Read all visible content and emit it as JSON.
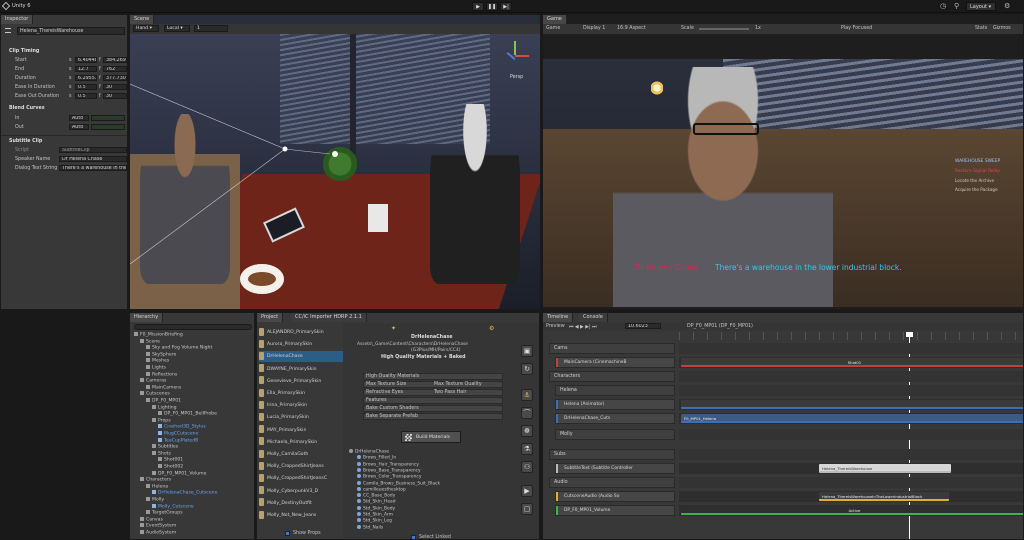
{
  "toolbar": {
    "project_name": "Unity 6",
    "play_icon": "play-icon",
    "pause_icon": "pause-icon",
    "step_icon": "step-icon",
    "layout_label": "Layout",
    "history_icon": "history-icon",
    "search_icon": "search-icon",
    "settings_icon": "gear-icon"
  },
  "inspector": {
    "tab": "Inspector",
    "object_name": "Helena_ThereisWarehouse",
    "clip_timing": "Clip Timing",
    "start_label": "Start",
    "start_s": "6.40448",
    "start_f": "384.269",
    "end_label": "End",
    "end_s": "12.7",
    "end_f": "762",
    "duration_label": "Duration",
    "duration_s": "6.29551",
    "duration_f": "377.7306",
    "ease_in_label": "Ease In Duration",
    "ease_in_s": "0.5",
    "ease_in_f": "30",
    "ease_out_label": "Ease Out Duration",
    "ease_out_s": "0.5",
    "ease_out_f": "30",
    "blend_curves": "Blend Curves",
    "in_label": "In",
    "in_value": "Auto",
    "out_label": "Out",
    "out_value": "Auto",
    "subtitle_clip": "Subtitle Clip",
    "script_label": "Script",
    "script_value": "SubtitleClip",
    "speaker_label": "Speaker Name",
    "speaker_value": "Dr Helena Chase",
    "dialog_label": "Dialog Text String",
    "dialog_value": "There's a warehouse in the lo"
  },
  "scene": {
    "tab": "Scene",
    "hand_tool": "Hand",
    "local_label": "Local",
    "grid_value": "1",
    "persp_label": "Persp"
  },
  "game": {
    "tab": "Game",
    "game_label": "Game",
    "display_label": "Display 1",
    "aspect_label": "16:9 Aspect",
    "scale_label": "Scale",
    "scale_value": "1x",
    "play_focused": "Play Focused",
    "stats_label": "Stats",
    "gizmos_label": "Gizmos",
    "subtitle_speaker": "Dr Helena Chase",
    "subtitle_text": "There's a warehouse in the lower industrial block.",
    "objectives": [
      "WAREHOUSE SWEEP",
      "Restore Signal Relay",
      "Locate the Archive",
      "Acquire the Package"
    ],
    "speaker_color": "#e0245a",
    "subtitle_color": "#3ac6e8"
  },
  "hierarchy": {
    "tab": "Hierarchy",
    "items": [
      {
        "label": "F0_MissionBriefing",
        "indent": 0,
        "blue": false
      },
      {
        "label": "Scene",
        "indent": 1,
        "blue": false
      },
      {
        "label": "Sky and Fog Volume Night",
        "indent": 2,
        "blue": false
      },
      {
        "label": "SkySphere",
        "indent": 2,
        "blue": false
      },
      {
        "label": "Meshes",
        "indent": 2,
        "blue": false
      },
      {
        "label": "Lights",
        "indent": 2,
        "blue": false
      },
      {
        "label": "Reflections",
        "indent": 2,
        "blue": false
      },
      {
        "label": "Cameras",
        "indent": 1,
        "blue": false
      },
      {
        "label": "MainCamera",
        "indent": 2,
        "blue": false
      },
      {
        "label": "Cutscenes",
        "indent": 1,
        "blue": false
      },
      {
        "label": "DP_F0_MP01",
        "indent": 2,
        "blue": false
      },
      {
        "label": "Lighting",
        "indent": 3,
        "blue": false
      },
      {
        "label": "DP_F0_MP01_BellProbe",
        "indent": 4,
        "blue": false
      },
      {
        "label": "Props",
        "indent": 3,
        "blue": false
      },
      {
        "label": "Crashed3D_Stylus",
        "indent": 4,
        "blue": true
      },
      {
        "label": "MugCCutscene",
        "indent": 4,
        "blue": true
      },
      {
        "label": "TeaCupPlatedB",
        "indent": 4,
        "blue": true
      },
      {
        "label": "Subtitles",
        "indent": 3,
        "blue": false
      },
      {
        "label": "Shots",
        "indent": 3,
        "blue": false
      },
      {
        "label": "Shot001",
        "indent": 4,
        "blue": false
      },
      {
        "label": "Shot002",
        "indent": 4,
        "blue": false
      },
      {
        "label": "DP_F0_MP01_Volume",
        "indent": 3,
        "blue": false
      },
      {
        "label": "Characters",
        "indent": 1,
        "blue": false
      },
      {
        "label": "Helena",
        "indent": 2,
        "blue": false
      },
      {
        "label": "DrHelenaChase_Cutscene",
        "indent": 3,
        "blue": true
      },
      {
        "label": "Molly",
        "indent": 2,
        "blue": false
      },
      {
        "label": "Molly_Cutscene",
        "indent": 3,
        "blue": true
      },
      {
        "label": "TargetGroups",
        "indent": 2,
        "blue": false
      },
      {
        "label": "Canvas",
        "indent": 1,
        "blue": false
      },
      {
        "label": "EventSystem",
        "indent": 1,
        "blue": false
      },
      {
        "label": "AudioSystem",
        "indent": 1,
        "blue": false
      }
    ]
  },
  "project": {
    "tab": "Project",
    "items": [
      "ALEJANDRO_PrimarySkin",
      "Aurora_PrimarySkin",
      "DrHelenaChase",
      "DWAYNE_PrimarySkin",
      "Genevieve_PrimarySkin",
      "Ella_PrimarySkin",
      "Irina_PrimarySkin",
      "Lucia_PrimarySkin",
      "MAY_PrimarySkin",
      "Michaela_PrimarySkin",
      "Molly_CamilaGoth",
      "Molly_CroppedShirtJeans",
      "Molly_CroppedShirtJeansC",
      "Molly_CyberpunkV3_D",
      "Molly_DestinyOutfit",
      "Molly_Not_New_Jeans"
    ],
    "selected": "DrHelenaChase",
    "show_props": "Show Props"
  },
  "importer": {
    "tab": "CC/iC Importer HDRP 2.1.1",
    "name": "DrHelenaChase",
    "path": "Assets\\_Game\\Content\\Characters\\DrHelenaChase",
    "sub_path": "(G3Plus/MH/Pairs/CC4)",
    "quality": "High Quality Materials + Baked",
    "options": [
      {
        "label": "High Quality Materials",
        "value": ""
      },
      {
        "label": "Max Texture Size",
        "value": "Max Texture Quality"
      },
      {
        "label": "Refractive Eyes",
        "value": "Two Pass Hair"
      },
      {
        "label": "Features",
        "value": ""
      },
      {
        "label": "Bake Custom Shaders",
        "value": ""
      },
      {
        "label": "Bake Separate Prefab",
        "value": ""
      }
    ],
    "build_button": "Build Materials",
    "tree": [
      "DrHelenaChase",
      "Brows_Filled_In",
      "Brows_Hair_Transparency",
      "Brows_Base_Transparency",
      "Brows_Color_Transparency",
      "Camila_Brows_Business_Suit_Black",
      "camilleuesthesktop",
      "CC_Base_Body",
      "Std_Skin_Head",
      "Std_Skin_Body",
      "Std_Skin_Arm",
      "Std_Skin_Leg",
      "Std_Nails"
    ],
    "select_linked": "Select Linked"
  },
  "timeline": {
    "tab": "Timeline",
    "console_tab": "Console",
    "preview_label": "Preview",
    "time_value": "10.6023",
    "sequence": "DP_F0_MP01 (DP_F0_MP01)",
    "groups": [
      "Cams",
      "Characters",
      "Helena",
      "Molly",
      "Subs",
      "Audio"
    ],
    "tracks": [
      {
        "label": "MainCamera (CinemachineB",
        "clip": "Shot01",
        "color": "#c44040"
      },
      {
        "label": "Helena (Animator)",
        "clip": "",
        "color": "#3a70b8"
      },
      {
        "label": "DrHelenaChase_Cuts",
        "clip": "F0_MP01_Helena",
        "color": "#3a70b8"
      },
      {
        "label": "SubtitleText (Subtitle Controller",
        "clip": "Helena_ThereisWarehouse",
        "color": "#bbbbbb"
      },
      {
        "label": "CutsceneAudio (Audio So",
        "clip": "Helena_ThereIsWarehouseInTheLowerIndustrialBlock",
        "color": "#e0b030"
      },
      {
        "label": "DP_F0_MP01_Volume",
        "clip": "Active",
        "color": "#3bb54a"
      }
    ]
  }
}
